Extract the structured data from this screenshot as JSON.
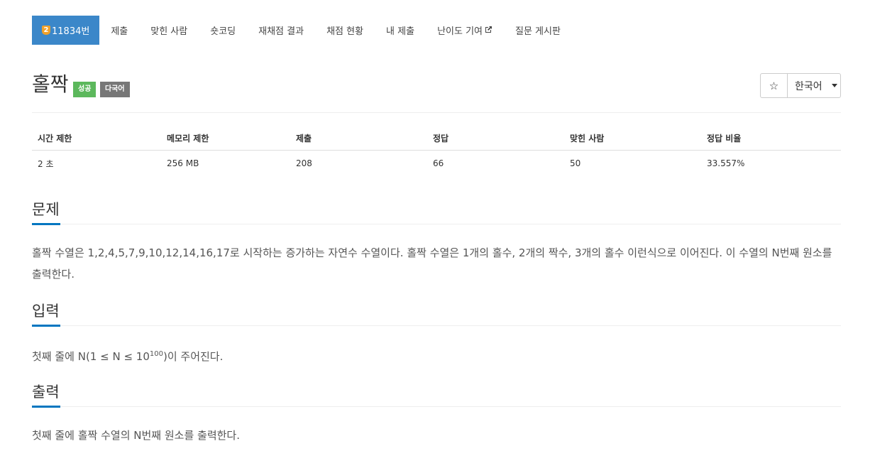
{
  "tabs": {
    "tier_icon": "2",
    "problem_number": "11834번",
    "items": [
      "제출",
      "맞힌 사람",
      "숏코딩",
      "재채점 결과",
      "채점 현황",
      "내 제출",
      "난이도 기여",
      "질문 게시판"
    ],
    "external_icon": "external-link-icon"
  },
  "problem": {
    "title": "홀짝",
    "badges": {
      "success": "성공",
      "multilang": "다국어"
    },
    "star": "☆",
    "language": "한국어"
  },
  "info_table": {
    "headers": [
      "시간 제한",
      "메모리 제한",
      "제출",
      "정답",
      "맞힌 사람",
      "정답 비율"
    ],
    "values": [
      "2 초",
      "256 MB",
      "208",
      "66",
      "50",
      "33.557%"
    ]
  },
  "sections": {
    "description": {
      "title": "문제",
      "body": "홀짝 수열은 1,2,4,5,7,9,10,12,14,16,17로 시작하는 증가하는 자연수 수열이다. 홀짝 수열은 1개의 홀수, 2개의 짝수, 3개의 홀수 이런식으로 이어진다. 이 수열의 N번째 원소를 출력한다."
    },
    "input": {
      "title": "입력",
      "body_prefix": "첫째 줄에 N(1 ≤ N ≤ 10",
      "body_sup": "100",
      "body_suffix": ")이 주어진다."
    },
    "output": {
      "title": "출력",
      "body": "첫째 줄에 홀짝 수열의 N번째 원소를 출력한다."
    }
  },
  "colors": {
    "accent": "#3b87c9",
    "success": "#5cb85c",
    "multilang": "#777777",
    "tier": "#f0a12a",
    "section_underline": "#0076c0"
  }
}
